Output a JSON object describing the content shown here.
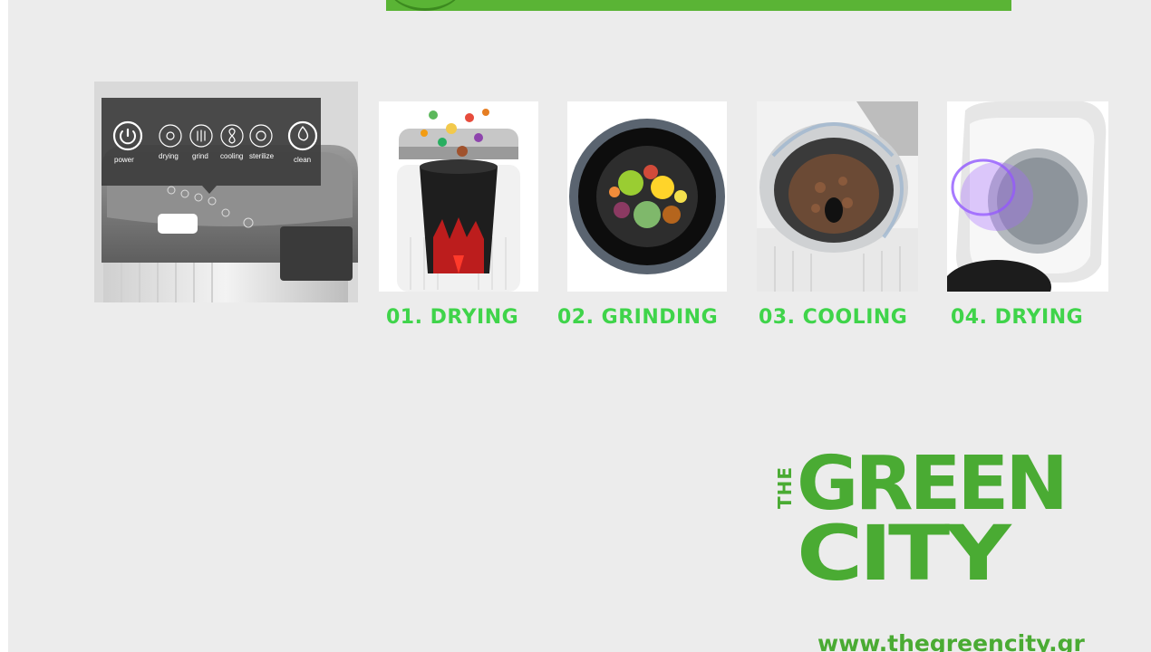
{
  "control_panel": {
    "buttons": [
      {
        "label": "power",
        "icon": "power-icon"
      },
      {
        "label": "drying",
        "icon": "sun-icon"
      },
      {
        "label": "grind",
        "icon": "grind-icon"
      },
      {
        "label": "cooling",
        "icon": "fan-icon"
      },
      {
        "label": "sterilize",
        "icon": "sterilize-icon"
      },
      {
        "label": "clean",
        "icon": "water-drop-icon"
      }
    ]
  },
  "steps": [
    {
      "caption": "01. DRYING",
      "image": "food-bin-heating"
    },
    {
      "caption": "02. GRINDING",
      "image": "food-grinding-bowl"
    },
    {
      "caption": "03. COOLING",
      "image": "bin-cooling-airflow"
    },
    {
      "caption": "04. DRYING",
      "image": "lid-uv-drying"
    }
  ],
  "logo": {
    "the": "THE",
    "line1": "GREEN",
    "line2": "CITY"
  },
  "website": "www.thegreencity.gr",
  "colors": {
    "brand_green": "#4aab33",
    "caption_green": "#3fd44a",
    "background": "#ececec"
  }
}
